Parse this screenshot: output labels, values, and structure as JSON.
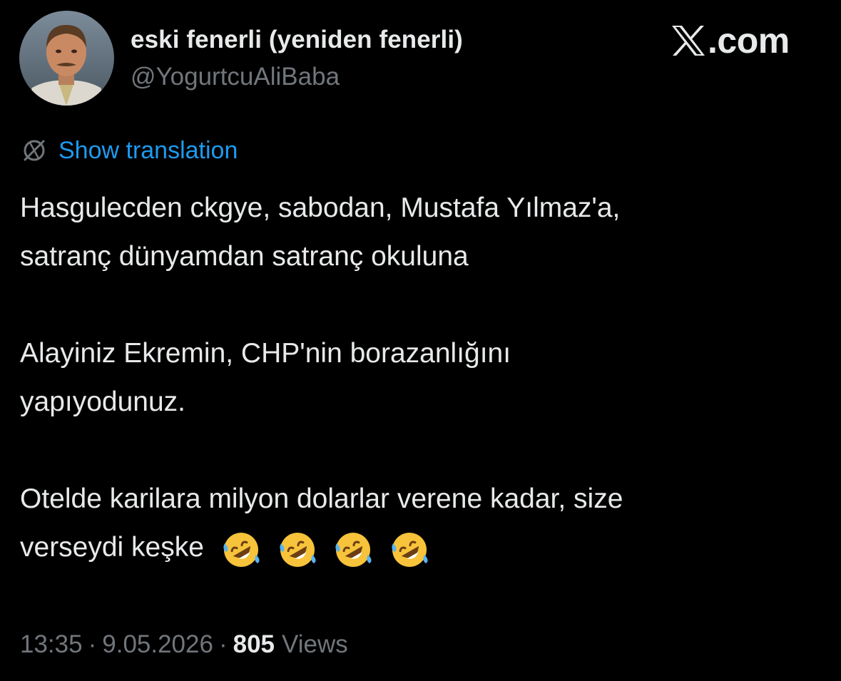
{
  "author": {
    "name": "eski fenerli (yeniden fenerli)",
    "handle": "@YogurtcuAliBaba"
  },
  "brand": {
    "text": ".com",
    "logo_icon": "x-logo-icon"
  },
  "translation": {
    "label": "Show translation",
    "icon": "translate-globe-icon"
  },
  "tweet": {
    "paragraphs": [
      {
        "lines": [
          "Hasgulecden ckgye, sabodan, Mustafa Yılmaz'a,",
          "satranç dünyamdan satranç okuluna"
        ]
      },
      {
        "lines": [
          "Alayiniz Ekremin, CHP'nin borazanlığını",
          "yapıyodunuz."
        ]
      },
      {
        "lines": [
          "Otelde karilara milyon dolarlar verene kadar, size",
          "verseydi keşke"
        ]
      }
    ],
    "emoji_count": 4,
    "emoji_icon": "rolling-on-floor-laughing-emoji"
  },
  "meta": {
    "time": "13:35",
    "separator": "·",
    "date": "9.05.2026",
    "views_count": "805",
    "views_label": "Views"
  },
  "colors": {
    "background": "#000000",
    "primary_text": "#e7e9ea",
    "secondary_text": "#71767b",
    "link": "#1d9bf0"
  }
}
